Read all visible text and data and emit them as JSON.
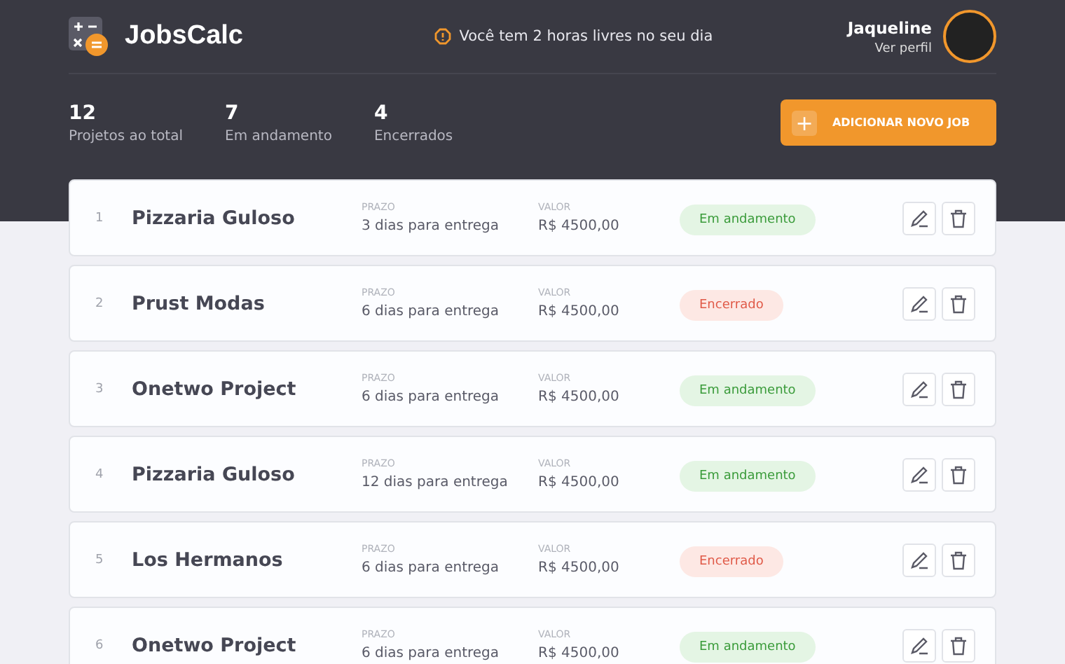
{
  "app": {
    "title": "JobsCalc"
  },
  "notice": {
    "text": "Você tem 2 horas livres no seu dia"
  },
  "profile": {
    "name": "Jaqueline",
    "link": "Ver perfil"
  },
  "stats": [
    {
      "value": "12",
      "label": "Projetos ao total"
    },
    {
      "value": "7",
      "label": "Em andamento"
    },
    {
      "value": "4",
      "label": "Encerrados"
    }
  ],
  "add_button": {
    "icon": "+",
    "label": "ADICIONAR NOVO JOB"
  },
  "jobs": [
    {
      "index": "1",
      "name": "Pizzaria Guloso",
      "deadline_label": "PRAZO",
      "deadline": "3 dias para entrega",
      "value_label": "VALOR",
      "value": "R$ 4500,00",
      "status": {
        "label": "Em andamento",
        "kind": "active"
      }
    },
    {
      "index": "2",
      "name": "Prust Modas",
      "deadline_label": "PRAZO",
      "deadline": "6 dias para entrega",
      "value_label": "VALOR",
      "value": "R$ 4500,00",
      "status": {
        "label": "Encerrado",
        "kind": "closed"
      }
    },
    {
      "index": "3",
      "name": "Onetwo Project",
      "deadline_label": "PRAZO",
      "deadline": "6 dias para entrega",
      "value_label": "VALOR",
      "value": "R$ 4500,00",
      "status": {
        "label": "Em andamento",
        "kind": "active"
      }
    },
    {
      "index": "4",
      "name": "Pizzaria Guloso",
      "deadline_label": "PRAZO",
      "deadline": "12 dias para entrega",
      "value_label": "VALOR",
      "value": "R$ 4500,00",
      "status": {
        "label": "Em andamento",
        "kind": "active"
      }
    },
    {
      "index": "5",
      "name": "Los Hermanos",
      "deadline_label": "PRAZO",
      "deadline": "6 dias para entrega",
      "value_label": "VALOR",
      "value": "R$ 4500,00",
      "status": {
        "label": "Encerrado",
        "kind": "closed"
      }
    },
    {
      "index": "6",
      "name": "Onetwo Project",
      "deadline_label": "PRAZO",
      "deadline": "6 dias para entrega",
      "value_label": "VALOR",
      "value": "R$ 4500,00",
      "status": {
        "label": "Em andamento",
        "kind": "active"
      }
    }
  ]
}
